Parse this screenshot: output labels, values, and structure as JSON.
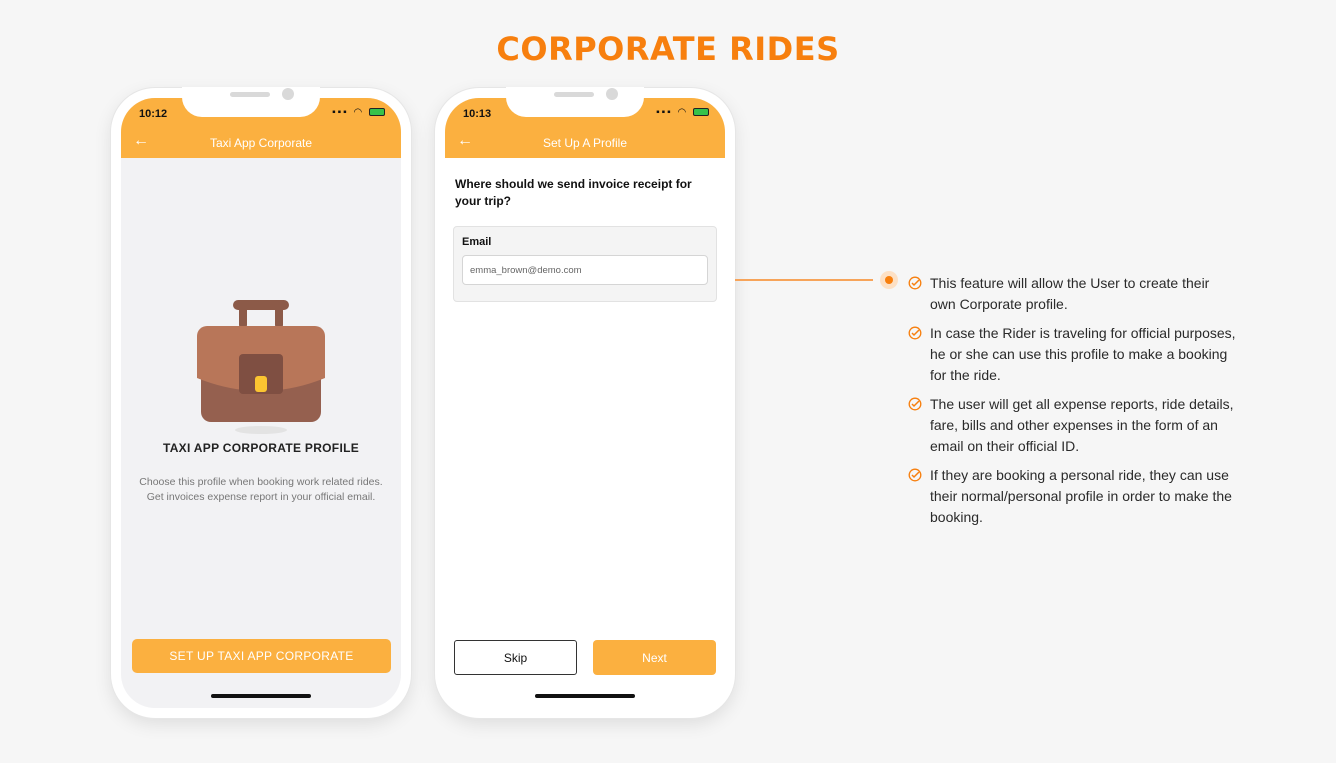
{
  "page": {
    "title": "CORPORATE RIDES",
    "accent_color": "#f77f0e",
    "app_bar_color": "#fbb040"
  },
  "phone1": {
    "status_time": "10:12",
    "app_bar_title": "Taxi App Corporate",
    "back_icon": "arrow-left-icon",
    "illustration": "briefcase-icon",
    "heading": "TAXI APP CORPORATE PROFILE",
    "description": "Choose this profile when booking work related rides. Get invoices expense report in your official email.",
    "cta_label": "SET UP TAXI APP CORPORATE"
  },
  "phone2": {
    "status_time": "10:13",
    "app_bar_title": "Set Up A Profile",
    "back_icon": "arrow-left-icon",
    "question": "Where should we send invoice receipt for your trip?",
    "email_label": "Email",
    "email_value": "emma_brown@demo.com",
    "skip_label": "Skip",
    "next_label": "Next"
  },
  "features": [
    "This feature will allow the User to create their own Corporate profile.",
    "In case the Rider is traveling for official purposes, he or she can use this profile to make a booking for the ride.",
    "The user will get all expense reports, ride details, fare, bills and other expenses in the form of an email on their official ID.",
    "If they are booking a personal ride, they can use their normal/personal profile in order to make the booking."
  ]
}
